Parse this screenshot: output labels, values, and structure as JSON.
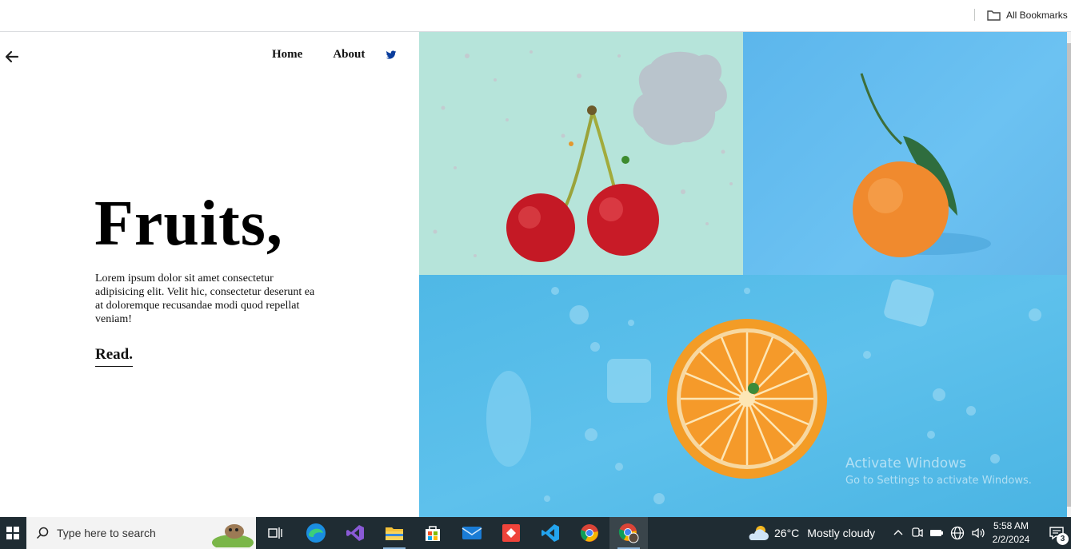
{
  "browser": {
    "bookmarks_label": "All Bookmarks"
  },
  "site": {
    "nav": {
      "home": "Home",
      "about": "About"
    },
    "hero": {
      "title": "Fruits,",
      "description": "Lorem ipsum dolor sit amet consectetur adipisicing elit. Velit hic, consectetur deserunt ea at doloremque recusandae modi quod repellat veniam!",
      "cta": "Read."
    },
    "images": [
      {
        "name": "cherries-image",
        "bg": "#b6e4da"
      },
      {
        "name": "tangerine-image",
        "bg": "#66bcef"
      },
      {
        "name": "orange-slice-image",
        "bg": "#52bae7"
      }
    ]
  },
  "watermark": {
    "line1": "Activate Windows",
    "line2": "Go to Settings to activate Windows."
  },
  "taskbar": {
    "search_placeholder": "Type here to search",
    "weather": {
      "temp": "26°C",
      "condition": "Mostly cloudy"
    },
    "time": "5:58 AM",
    "date": "2/2/2024",
    "notifications": "3"
  }
}
